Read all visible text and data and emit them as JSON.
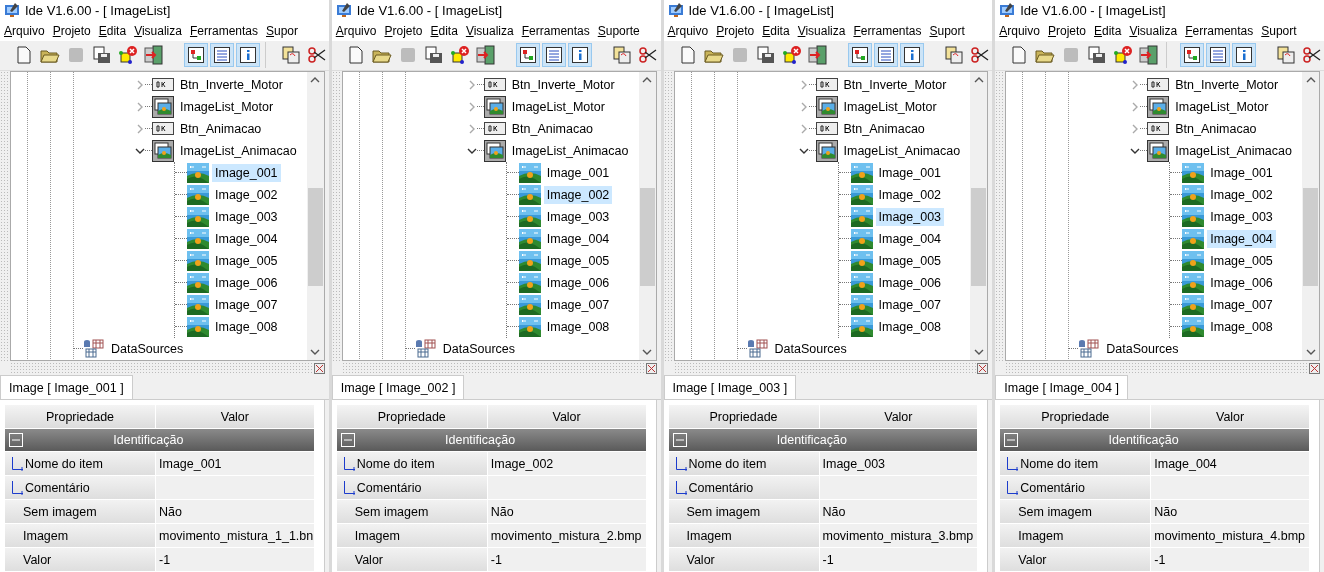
{
  "panels": [
    {
      "title": "Ide V1.6.00  - [ ImageList]",
      "menu": [
        "Arquivo",
        "Projeto",
        "Edita",
        "Visualiza",
        "Ferramentas",
        "Supor"
      ],
      "toolbar": [
        {
          "kind": "new",
          "pressed": false,
          "disabled": false
        },
        {
          "kind": "open",
          "pressed": false,
          "disabled": false
        },
        {
          "kind": "save",
          "pressed": false,
          "disabled": true
        },
        {
          "kind": "saveall",
          "pressed": false,
          "disabled": false
        },
        {
          "kind": "component",
          "pressed": false,
          "disabled": false
        },
        {
          "kind": "exit",
          "pressed": false,
          "disabled": false
        },
        {
          "kind": "sep"
        },
        {
          "kind": "tree",
          "pressed": true,
          "disabled": false
        },
        {
          "kind": "list",
          "pressed": true,
          "disabled": false
        },
        {
          "kind": "info",
          "pressed": true,
          "disabled": false
        },
        {
          "kind": "sep"
        },
        {
          "kind": "paste",
          "pressed": false,
          "disabled": false
        },
        {
          "kind": "cut",
          "pressed": false,
          "disabled": false
        }
      ],
      "tree": {
        "nodes": [
          {
            "kind": "button",
            "label": "Btn_Inverte_Motor",
            "expanded": false
          },
          {
            "kind": "imagelist",
            "label": "ImageList_Motor",
            "expanded": false
          },
          {
            "kind": "button",
            "label": "Btn_Animacao",
            "expanded": false
          },
          {
            "kind": "imagelist",
            "label": "ImageList_Animacao",
            "expanded": true,
            "children": [
              {
                "label": "Image_001",
                "selected": true
              },
              {
                "label": "Image_002",
                "selected": false
              },
              {
                "label": "Image_003",
                "selected": false
              },
              {
                "label": "Image_004",
                "selected": false
              },
              {
                "label": "Image_005",
                "selected": false
              },
              {
                "label": "Image_006",
                "selected": false
              },
              {
                "label": "Image_007",
                "selected": false
              },
              {
                "label": "Image_008",
                "selected": false
              }
            ]
          }
        ],
        "outer_nodes": [
          {
            "kind": "datasources",
            "label": "DataSources"
          }
        ]
      },
      "tab": "Image [ Image_001 ]",
      "columns": [
        "Propriedade",
        "Valor"
      ],
      "group": "Identificação",
      "rows": [
        {
          "kind": "child",
          "name": "Nome do item",
          "value": "Image_001"
        },
        {
          "kind": "child",
          "name": "Comentário"
        },
        {
          "kind": "plain",
          "name": "Sem imagem",
          "value": "Não"
        },
        {
          "kind": "plain",
          "name": "Imagem",
          "value": "movimento_mistura_1_1.bn"
        },
        {
          "kind": "plain",
          "name": "Valor",
          "value": "-1"
        }
      ]
    },
    {
      "title": "Ide V1.6.00  - [ ImageList]",
      "menu": [
        "Arquivo",
        "Projeto",
        "Edita",
        "Visualiza",
        "Ferramentas",
        "Suporte"
      ],
      "toolbar": [
        {
          "kind": "new",
          "pressed": false,
          "disabled": false
        },
        {
          "kind": "open",
          "pressed": false,
          "disabled": false
        },
        {
          "kind": "save",
          "pressed": false,
          "disabled": true
        },
        {
          "kind": "saveall",
          "pressed": false,
          "disabled": false
        },
        {
          "kind": "component",
          "pressed": false,
          "disabled": false
        },
        {
          "kind": "exit",
          "pressed": false,
          "disabled": false
        },
        {
          "kind": "sep"
        },
        {
          "kind": "tree",
          "pressed": true,
          "disabled": false
        },
        {
          "kind": "list",
          "pressed": true,
          "disabled": false
        },
        {
          "kind": "info",
          "pressed": true,
          "disabled": false
        },
        {
          "kind": "sep"
        },
        {
          "kind": "paste",
          "pressed": false,
          "disabled": false
        },
        {
          "kind": "cut",
          "pressed": false,
          "disabled": false
        }
      ],
      "tree": {
        "nodes": [
          {
            "kind": "button",
            "label": "Btn_Inverte_Motor",
            "expanded": false
          },
          {
            "kind": "imagelist",
            "label": "ImageList_Motor",
            "expanded": false
          },
          {
            "kind": "button",
            "label": "Btn_Animacao",
            "expanded": false
          },
          {
            "kind": "imagelist",
            "label": "ImageList_Animacao",
            "expanded": true,
            "children": [
              {
                "label": "Image_001",
                "selected": false
              },
              {
                "label": "Image_002",
                "selected": true
              },
              {
                "label": "Image_003",
                "selected": false
              },
              {
                "label": "Image_004",
                "selected": false
              },
              {
                "label": "Image_005",
                "selected": false
              },
              {
                "label": "Image_006",
                "selected": false
              },
              {
                "label": "Image_007",
                "selected": false
              },
              {
                "label": "Image_008",
                "selected": false
              }
            ]
          }
        ],
        "outer_nodes": [
          {
            "kind": "datasources",
            "label": "DataSources"
          }
        ]
      },
      "tab": "Image [ Image_002 ]",
      "columns": [
        "Propriedade",
        "Valor"
      ],
      "group": "Identificação",
      "rows": [
        {
          "kind": "child",
          "name": "Nome do item",
          "value": "Image_002"
        },
        {
          "kind": "child",
          "name": "Comentário"
        },
        {
          "kind": "plain",
          "name": "Sem imagem",
          "value": "Não"
        },
        {
          "kind": "plain",
          "name": "Imagem",
          "value": "movimento_mistura_2.bmp"
        },
        {
          "kind": "plain",
          "name": "Valor",
          "value": "-1"
        }
      ]
    },
    {
      "title": "Ide V1.6.00  - [ ImageList]",
      "menu": [
        "Arquivo",
        "Projeto",
        "Edita",
        "Visualiza",
        "Ferramentas",
        "Suport"
      ],
      "toolbar": [
        {
          "kind": "new",
          "pressed": false,
          "disabled": false
        },
        {
          "kind": "open",
          "pressed": false,
          "disabled": false
        },
        {
          "kind": "save",
          "pressed": false,
          "disabled": true
        },
        {
          "kind": "saveall",
          "pressed": false,
          "disabled": false
        },
        {
          "kind": "component",
          "pressed": false,
          "disabled": false
        },
        {
          "kind": "exit",
          "pressed": false,
          "disabled": false
        },
        {
          "kind": "sep"
        },
        {
          "kind": "tree",
          "pressed": true,
          "disabled": false
        },
        {
          "kind": "list",
          "pressed": true,
          "disabled": false
        },
        {
          "kind": "info",
          "pressed": true,
          "disabled": false
        },
        {
          "kind": "sep"
        },
        {
          "kind": "paste",
          "pressed": false,
          "disabled": false
        },
        {
          "kind": "cut",
          "pressed": false,
          "disabled": false
        }
      ],
      "tree": {
        "nodes": [
          {
            "kind": "button",
            "label": "Btn_Inverte_Motor",
            "expanded": false
          },
          {
            "kind": "imagelist",
            "label": "ImageList_Motor",
            "expanded": false
          },
          {
            "kind": "button",
            "label": "Btn_Animacao",
            "expanded": false
          },
          {
            "kind": "imagelist",
            "label": "ImageList_Animacao",
            "expanded": true,
            "children": [
              {
                "label": "Image_001",
                "selected": false
              },
              {
                "label": "Image_002",
                "selected": false
              },
              {
                "label": "Image_003",
                "selected": true
              },
              {
                "label": "Image_004",
                "selected": false
              },
              {
                "label": "Image_005",
                "selected": false
              },
              {
                "label": "Image_006",
                "selected": false
              },
              {
                "label": "Image_007",
                "selected": false
              },
              {
                "label": "Image_008",
                "selected": false
              }
            ]
          }
        ],
        "outer_nodes": [
          {
            "kind": "datasources",
            "label": "DataSources"
          }
        ]
      },
      "tab": "Image [ Image_003 ]",
      "columns": [
        "Propriedade",
        "Valor"
      ],
      "group": "Identificação",
      "rows": [
        {
          "kind": "child",
          "name": "Nome do item",
          "value": "Image_003"
        },
        {
          "kind": "child",
          "name": "Comentário"
        },
        {
          "kind": "plain",
          "name": "Sem imagem",
          "value": "Não"
        },
        {
          "kind": "plain",
          "name": "Imagem",
          "value": "movimento_mistura_3.bmp"
        },
        {
          "kind": "plain",
          "name": "Valor",
          "value": "-1"
        }
      ]
    },
    {
      "title": "Ide V1.6.00  - [ ImageList]",
      "menu": [
        "Arquivo",
        "Projeto",
        "Edita",
        "Visualiza",
        "Ferramentas",
        "Suport"
      ],
      "toolbar": [
        {
          "kind": "new",
          "pressed": false,
          "disabled": false
        },
        {
          "kind": "open",
          "pressed": false,
          "disabled": false
        },
        {
          "kind": "save",
          "pressed": false,
          "disabled": true
        },
        {
          "kind": "saveall",
          "pressed": false,
          "disabled": false
        },
        {
          "kind": "component",
          "pressed": false,
          "disabled": false
        },
        {
          "kind": "exit",
          "pressed": false,
          "disabled": false
        },
        {
          "kind": "sep"
        },
        {
          "kind": "tree",
          "pressed": true,
          "disabled": false
        },
        {
          "kind": "list",
          "pressed": true,
          "disabled": false
        },
        {
          "kind": "info",
          "pressed": true,
          "disabled": false
        },
        {
          "kind": "sep"
        },
        {
          "kind": "paste",
          "pressed": false,
          "disabled": false
        },
        {
          "kind": "cut",
          "pressed": false,
          "disabled": false
        }
      ],
      "tree": {
        "nodes": [
          {
            "kind": "button",
            "label": "Btn_Inverte_Motor",
            "expanded": false
          },
          {
            "kind": "imagelist",
            "label": "ImageList_Motor",
            "expanded": false
          },
          {
            "kind": "button",
            "label": "Btn_Animacao",
            "expanded": false
          },
          {
            "kind": "imagelist",
            "label": "ImageList_Animacao",
            "expanded": true,
            "children": [
              {
                "label": "Image_001",
                "selected": false
              },
              {
                "label": "Image_002",
                "selected": false
              },
              {
                "label": "Image_003",
                "selected": false
              },
              {
                "label": "Image_004",
                "selected": true
              },
              {
                "label": "Image_005",
                "selected": false
              },
              {
                "label": "Image_006",
                "selected": false
              },
              {
                "label": "Image_007",
                "selected": false
              },
              {
                "label": "Image_008",
                "selected": false
              }
            ]
          }
        ],
        "outer_nodes": [
          {
            "kind": "datasources",
            "label": "DataSources"
          }
        ]
      },
      "tab": "Image [ Image_004 ]",
      "columns": [
        "Propriedade",
        "Valor"
      ],
      "group": "Identificação",
      "rows": [
        {
          "kind": "child",
          "name": "Nome do item",
          "value": "Image_004"
        },
        {
          "kind": "child",
          "name": "Comentário"
        },
        {
          "kind": "plain",
          "name": "Sem imagem",
          "value": "Não"
        },
        {
          "kind": "plain",
          "name": "Imagem",
          "value": "movimento_mistura_4.bmp"
        },
        {
          "kind": "plain",
          "name": "Valor",
          "value": "-1"
        }
      ]
    }
  ]
}
